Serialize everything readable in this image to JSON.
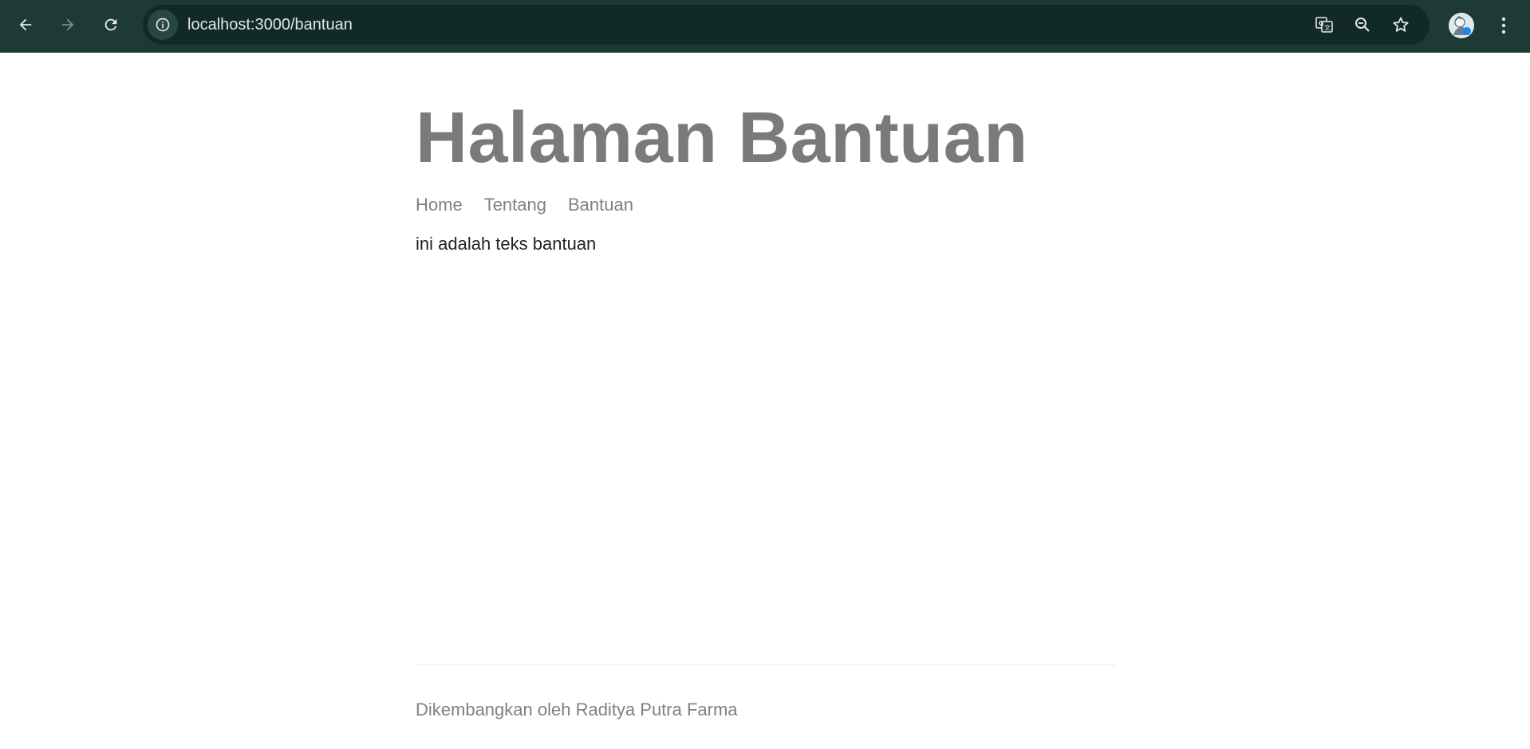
{
  "browser": {
    "url": "localhost:3000/bantuan",
    "icons": {
      "back": "arrow-left-icon",
      "forward": "arrow-right-icon",
      "reload": "reload-icon",
      "site_info": "info-icon",
      "translate": "translate-icon",
      "zoom": "zoom-out-icon",
      "bookmark": "star-icon",
      "profile": "avatar",
      "menu": "kebab-menu-icon"
    },
    "colors": {
      "toolbar": "#1e3a35",
      "omnibox": "#122a26",
      "icon": "#e3e7e6",
      "icon_disabled": "#7c8f8b"
    }
  },
  "page": {
    "title": "Halaman Bantuan",
    "nav": [
      {
        "label": "Home"
      },
      {
        "label": "Tentang"
      },
      {
        "label": "Bantuan"
      }
    ],
    "content": "ini adalah teks bantuan",
    "footer": "Dikembangkan oleh Raditya Putra Farma",
    "colors": {
      "title": "#7a7a7a",
      "nav": "#808080",
      "text": "#222222",
      "footer": "#808080"
    }
  }
}
